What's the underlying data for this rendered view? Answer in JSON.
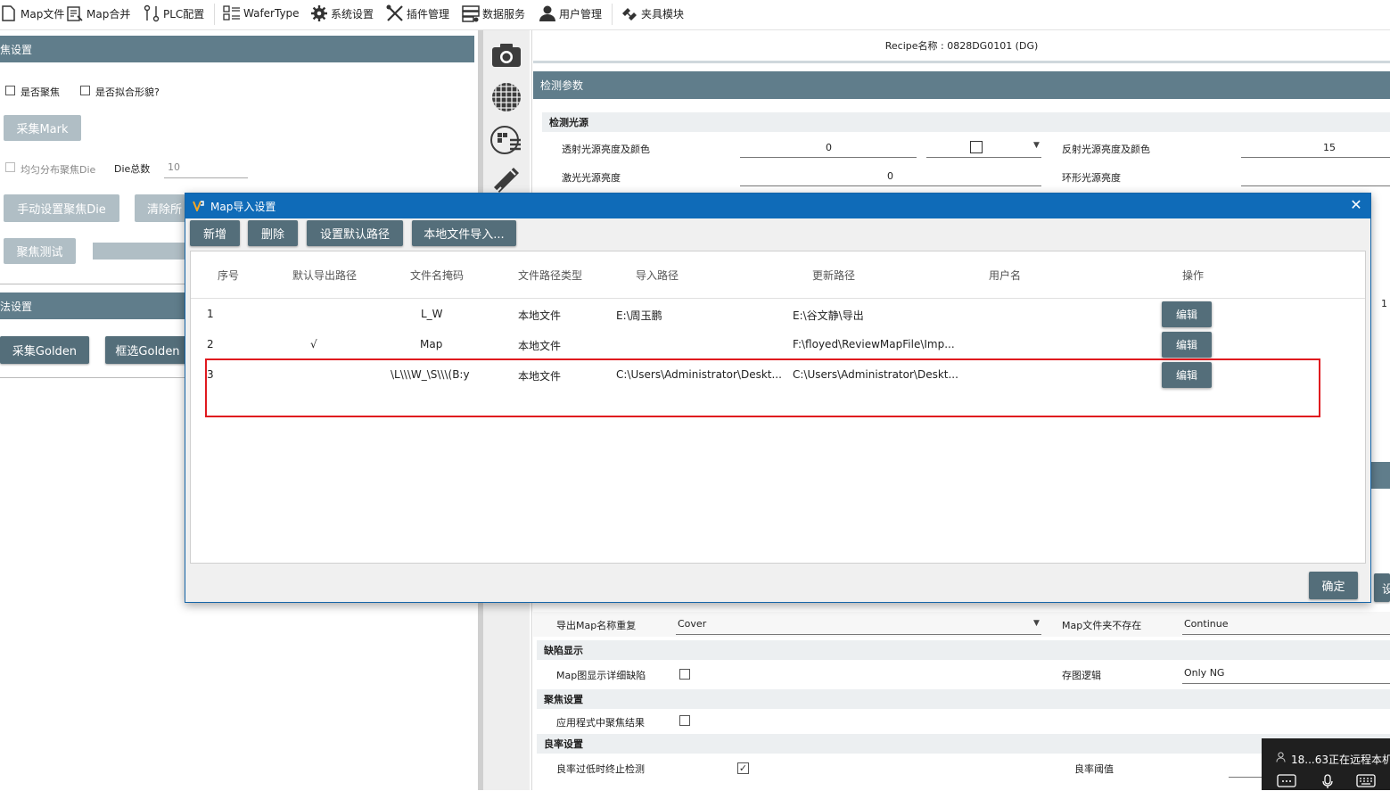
{
  "toolbar": {
    "items": [
      {
        "label": "Map文件",
        "icon": "map-file-icon"
      },
      {
        "label": "Map合并",
        "icon": "map-merge-icon"
      },
      {
        "label": "PLC配置",
        "icon": "plc-icon"
      },
      {
        "label": "WaferType",
        "icon": "wafer-type-icon"
      },
      {
        "label": "系统设置",
        "icon": "gear-icon"
      },
      {
        "label": "插件管理",
        "icon": "tools-icon"
      },
      {
        "label": "数据服务",
        "icon": "database-icon"
      },
      {
        "label": "用户管理",
        "icon": "user-icon"
      },
      {
        "label": "夹具模块",
        "icon": "fixture-icon"
      }
    ]
  },
  "left": {
    "focus_section": "焦设置",
    "cb_focus": "是否聚焦",
    "cb_fit": "是否拟合形貌?",
    "collect_mark": "采集Mark",
    "cb_uniform": "均匀分布聚焦Die",
    "die_total_label": "Die总数",
    "die_total_value": "10",
    "manual_focus_btn": "手动设置聚焦Die",
    "clear_btn": "清除所",
    "focus_test_btn": "聚焦测试",
    "algo_section": "法设置",
    "collect_golden": "采集Golden",
    "select_golden": "框选Golden"
  },
  "right": {
    "recipe": "Recipe名称 : 0828DG0101 (DG)",
    "detect_params": "检测参数",
    "light_source": "检测光源",
    "trans_light_label": "透射光源亮度及颜色",
    "trans_light_value": "0",
    "refl_light_label": "反射光源亮度及颜色",
    "refl_light_value": "15",
    "laser_label": "激光光源亮度",
    "laser_value": "0",
    "ring_label": "环形光源亮度",
    "edge_value": "1",
    "export_dup_label": "导出Map名称重复",
    "export_dup_value": "Cover",
    "folder_missing_label": "Map文件夹不存在",
    "folder_missing_value": "Continue",
    "defect_display": "缺陷显示",
    "map_detail_label": "Map图显示详细缺陷",
    "save_logic_label": "存图逻辑",
    "save_logic_value": "Only NG",
    "focus_settings": "聚焦设置",
    "apply_focus_label": "应用程式中聚焦结果",
    "yield_settings": "良率设置",
    "yield_stop_label": "良率过低时终止检测",
    "yield_threshold_label": "良率阈值",
    "partial_btn": "设"
  },
  "dialog": {
    "title": "Map导入设置",
    "btn_add": "新增",
    "btn_delete": "删除",
    "btn_default_path": "设置默认路径",
    "btn_local_import": "本地文件导入...",
    "headers": [
      "序号",
      "默认导出路径",
      "文件名掩码",
      "文件路径类型",
      "导入路径",
      "更新路径",
      "用户名",
      "操作"
    ],
    "rows": [
      {
        "idx": "1",
        "default": "",
        "mask": "L_W",
        "type": "本地文件",
        "import": "E:\\周玉鹏",
        "update": "E:\\谷文静\\导出",
        "user": "",
        "op": "编辑"
      },
      {
        "idx": "2",
        "default": "√",
        "mask": "Map",
        "type": "本地文件",
        "import": "",
        "update": "F:\\floyed\\ReviewMapFile\\Imp...",
        "user": "",
        "op": "编辑"
      },
      {
        "idx": "3",
        "default": "",
        "mask": "\\L\\\\\\W_\\S\\\\\\(B:y",
        "type": "本地文件",
        "import": "C:\\Users\\Administrator\\Deskt...",
        "update": "C:\\Users\\Administrator\\Deskt...",
        "user": "",
        "op": "编辑"
      }
    ],
    "ok": "确定",
    "highlight_color": "#e0191f"
  },
  "remote": {
    "text": "18...63正在远程本机"
  },
  "colors": {
    "section_bar": "#607d8b",
    "dialog_title": "#0f6bb8",
    "button_dark": "#546e7a",
    "button_light": "#b0bec5"
  }
}
